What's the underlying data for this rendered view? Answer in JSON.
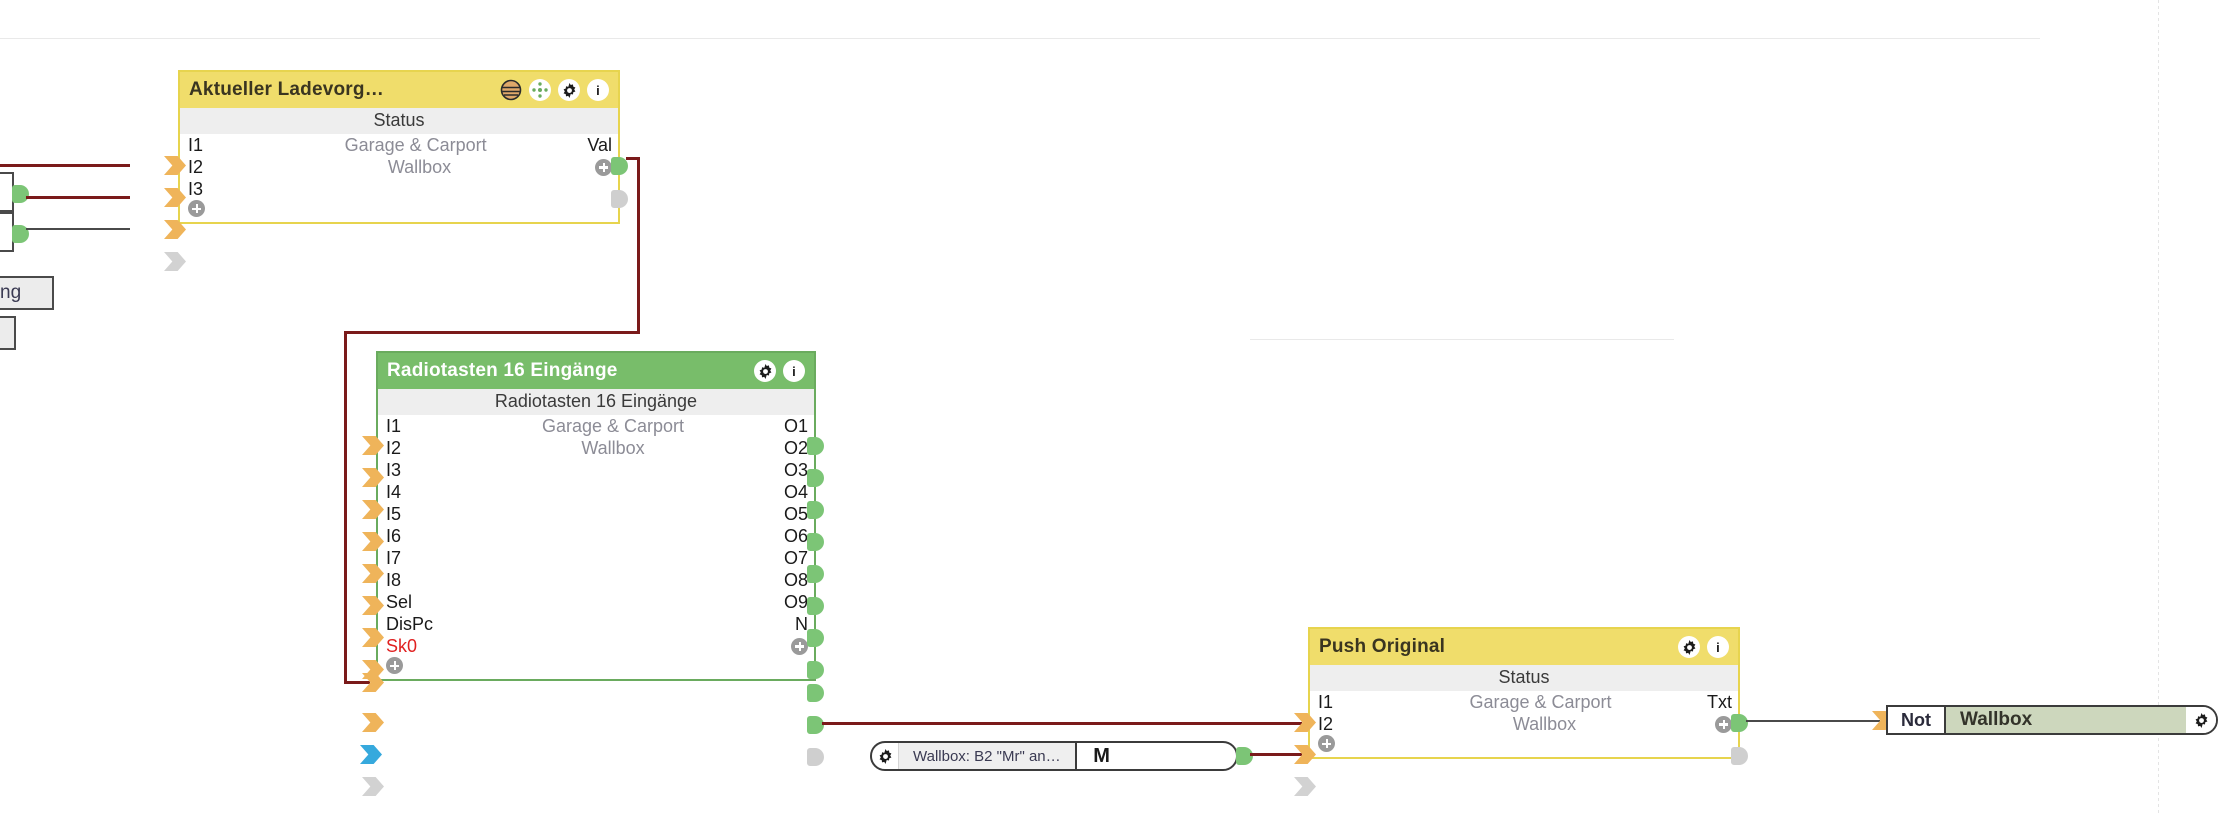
{
  "canvas": {
    "background_color": "#ffffff",
    "wire_color": "#7a1a1a",
    "wire_color_secondary": "#4a4a4a",
    "guide_color": "#e9e9e9"
  },
  "nodes": {
    "aktueller": {
      "title": "Aktueller Ladevorg…",
      "header_color": "#f0dd6b",
      "border_color": "#e7d44e",
      "subtitle": "Status",
      "icons": [
        "lamp-icon",
        "move-icon",
        "gear-icon",
        "info-icon"
      ],
      "rows": [
        {
          "in": "I1",
          "mid": "Garage & Carport",
          "out": "Val"
        },
        {
          "in": "I2",
          "mid": "Wallbox",
          "out": "plus"
        },
        {
          "in": "I3",
          "mid": "",
          "out": ""
        },
        {
          "in": "plus",
          "mid": "",
          "out": ""
        }
      ]
    },
    "radiotasten": {
      "title": "Radiotasten 16 Eingänge",
      "header_color": "#78bd6a",
      "border_color": "#6aab5e",
      "subtitle": "Radiotasten 16 Eingänge",
      "icons": [
        "gear-icon",
        "info-icon"
      ],
      "rows": [
        {
          "in": "I1",
          "mid": "Garage & Carport",
          "out": "O1"
        },
        {
          "in": "I2",
          "mid": "Wallbox",
          "out": "O2"
        },
        {
          "in": "I3",
          "mid": "",
          "out": "O3"
        },
        {
          "in": "I4",
          "mid": "",
          "out": "O4"
        },
        {
          "in": "I5",
          "mid": "",
          "out": "O5"
        },
        {
          "in": "I6",
          "mid": "",
          "out": "O6"
        },
        {
          "in": "I7",
          "mid": "",
          "out": "O7"
        },
        {
          "in": "I8",
          "mid": "",
          "out": "O8"
        },
        {
          "in": "Sel",
          "mid": "",
          "out": "O9"
        },
        {
          "in": "DisPc",
          "mid": "",
          "out": "N"
        },
        {
          "in": "Sk0",
          "mid": "",
          "out": "plus"
        },
        {
          "in": "plus",
          "mid": "",
          "out": ""
        }
      ]
    },
    "push_original": {
      "title": "Push Original",
      "header_color": "#f0dd6b",
      "border_color": "#e7d44e",
      "subtitle": "Status",
      "icons": [
        "gear-icon",
        "info-icon"
      ],
      "rows": [
        {
          "in": "I1",
          "mid": "Garage & Carport",
          "out": "Txt"
        },
        {
          "in": "I2",
          "mid": "Wallbox",
          "out": "plus"
        },
        {
          "in": "plus",
          "mid": "",
          "out": ""
        }
      ]
    }
  },
  "widgets": {
    "message_pill": {
      "gear_icon": "gear-icon",
      "text": "Wallbox: B2 \"Mr\" an…",
      "button_label": "M"
    },
    "not_wallbox": {
      "prefix_label": "Not",
      "name": "Wallbox",
      "gear_icon": "gear-icon",
      "name_background": "#cdd7bd"
    }
  },
  "edge_elements": {
    "partial_label": "ng"
  }
}
